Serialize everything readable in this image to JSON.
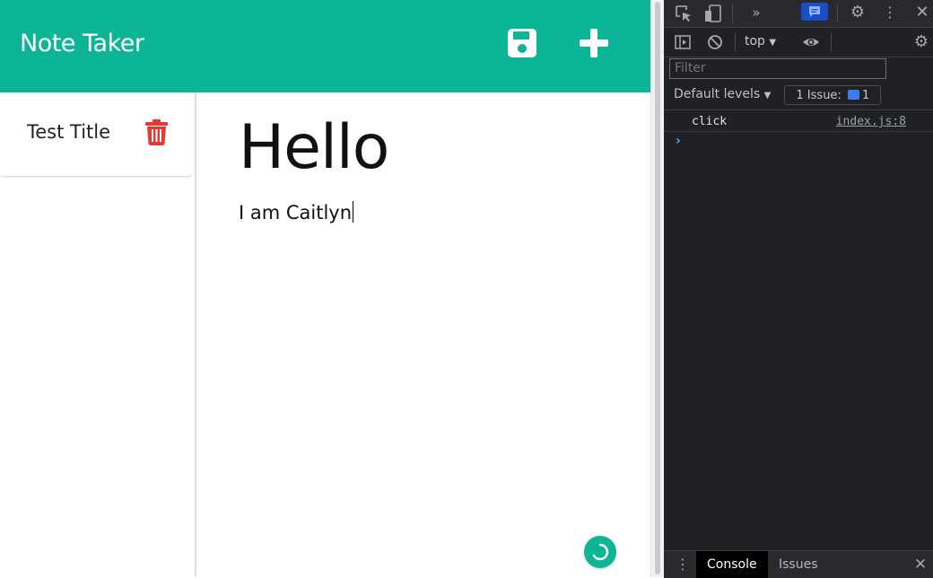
{
  "app": {
    "brand": "Note Taker",
    "colors": {
      "accent": "#0cb596",
      "danger": "#e53935"
    },
    "icons": {
      "save": "save-icon",
      "add": "plus-icon",
      "delete": "trash-icon",
      "helper": "loading-icon"
    },
    "notes": [
      {
        "title": "Test Title"
      }
    ],
    "active_note": {
      "title": "Hello",
      "text": "I am Caitlyn"
    }
  },
  "devtools": {
    "context": "top",
    "filter_placeholder": "Filter",
    "levels_label": "Default levels",
    "issues_label": "1 Issue:",
    "issues_count": "1",
    "log": [
      {
        "message": "click",
        "source": "index.js:8"
      }
    ],
    "prompt_symbol": "›",
    "drawer_tabs": [
      {
        "label": "Console"
      },
      {
        "label": "Issues"
      }
    ]
  }
}
